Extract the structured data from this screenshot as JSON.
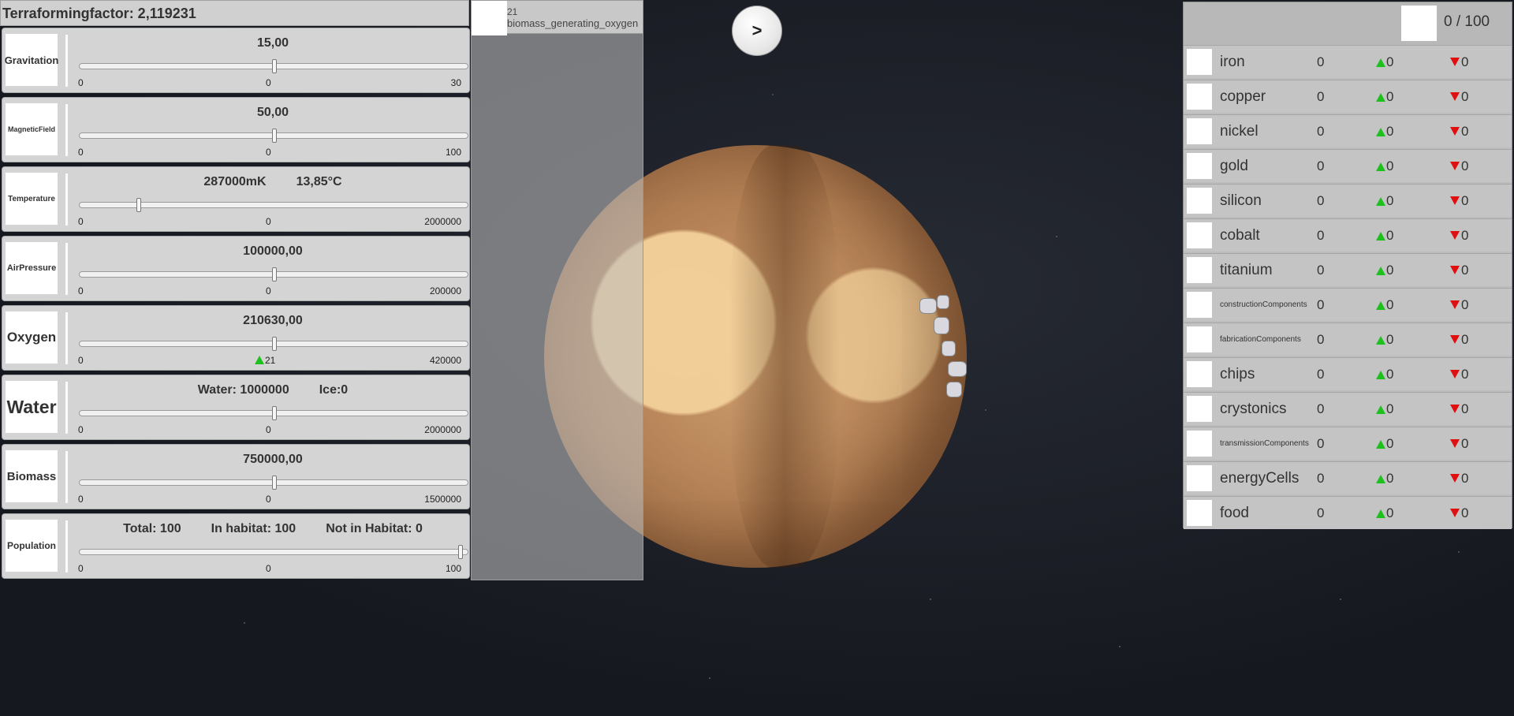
{
  "header": {
    "terraforming_label": "Terraformingfactor: 2,119231"
  },
  "stats": [
    {
      "label": "Gravitation",
      "label_size": 13,
      "values": [
        "15,00"
      ],
      "level": 0.5,
      "min": "0",
      "mid": "0",
      "max": "30",
      "delta": ""
    },
    {
      "label": "MagneticField",
      "label_size": 9,
      "values": [
        "50,00"
      ],
      "level": 0.5,
      "min": "0",
      "mid": "0",
      "max": "100",
      "delta": ""
    },
    {
      "label": "Temperature",
      "label_size": 10,
      "values": [
        "287000mK",
        "13,85°C"
      ],
      "level": 0.15,
      "min": "0",
      "mid": "0",
      "max": "2000000",
      "delta": ""
    },
    {
      "label": "AirPressure",
      "label_size": 11,
      "values": [
        "100000,00"
      ],
      "level": 0.5,
      "min": "0",
      "mid": "0",
      "max": "200000",
      "delta": ""
    },
    {
      "label": "Oxygen",
      "label_size": 17,
      "values": [
        "210630,00"
      ],
      "level": 0.501,
      "min": "0",
      "mid": "",
      "max": "420000",
      "delta": "21"
    },
    {
      "label": "Water",
      "label_size": 23,
      "values": [
        "Water: 1000000",
        "Ice:0"
      ],
      "level": 0.5,
      "min": "0",
      "mid": "0",
      "max": "2000000",
      "delta": ""
    },
    {
      "label": "Biomass",
      "label_size": 15,
      "values": [
        "750000,00"
      ],
      "level": 0.5,
      "min": "0",
      "mid": "0",
      "max": "1500000",
      "delta": ""
    },
    {
      "label": "Population",
      "label_size": 12,
      "values": [
        "Total: 100",
        "In habitat: 100",
        "Not in Habitat: 0"
      ],
      "level": 0.98,
      "min": "0",
      "mid": "0",
      "max": "100",
      "delta": ""
    }
  ],
  "effect": {
    "amount": "21",
    "name": "biomass_generating_oxygen"
  },
  "next_button": {
    "label": ">"
  },
  "storage": {
    "label": "0 / 100"
  },
  "resources": [
    {
      "name": "iron",
      "small": false,
      "amount": "0",
      "up": "0",
      "down": "0"
    },
    {
      "name": "copper",
      "small": false,
      "amount": "0",
      "up": "0",
      "down": "0"
    },
    {
      "name": "nickel",
      "small": false,
      "amount": "0",
      "up": "0",
      "down": "0"
    },
    {
      "name": "gold",
      "small": false,
      "amount": "0",
      "up": "0",
      "down": "0"
    },
    {
      "name": "silicon",
      "small": false,
      "amount": "0",
      "up": "0",
      "down": "0"
    },
    {
      "name": "cobalt",
      "small": false,
      "amount": "0",
      "up": "0",
      "down": "0"
    },
    {
      "name": "titanium",
      "small": false,
      "amount": "0",
      "up": "0",
      "down": "0"
    },
    {
      "name": "constructionComponents",
      "small": true,
      "amount": "0",
      "up": "0",
      "down": "0"
    },
    {
      "name": "fabricationComponents",
      "small": true,
      "amount": "0",
      "up": "0",
      "down": "0"
    },
    {
      "name": "chips",
      "small": false,
      "amount": "0",
      "up": "0",
      "down": "0"
    },
    {
      "name": "crystonics",
      "small": false,
      "amount": "0",
      "up": "0",
      "down": "0"
    },
    {
      "name": "transmissionComponents",
      "small": true,
      "amount": "0",
      "up": "0",
      "down": "0"
    },
    {
      "name": "energyCells",
      "small": false,
      "amount": "0",
      "up": "0",
      "down": "0"
    },
    {
      "name": "food",
      "small": false,
      "amount": "0",
      "up": "0",
      "down": "0"
    }
  ]
}
